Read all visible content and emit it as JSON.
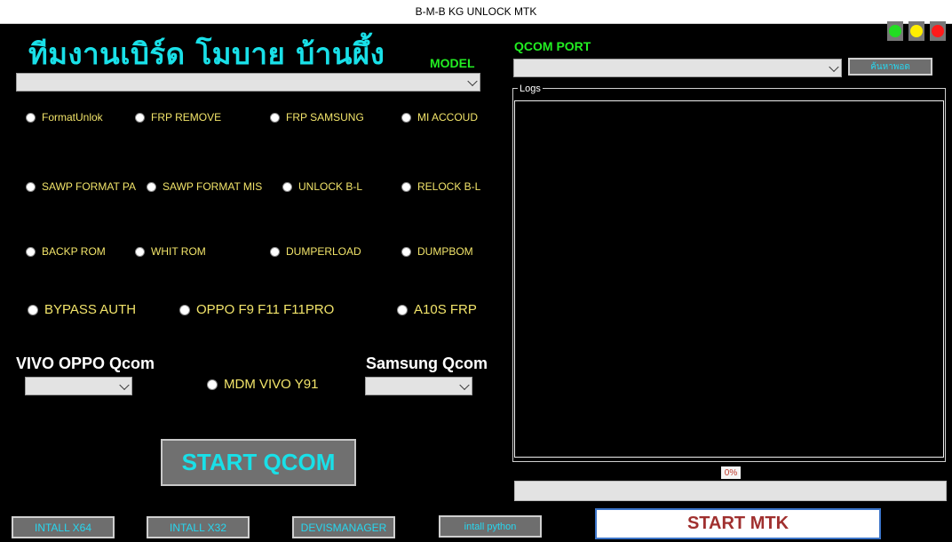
{
  "window": {
    "title": "B-M-B KG UNLOCK MTK"
  },
  "banner": {
    "text": "ทีมงานเบิร์ด โมบาย บ้านผึ้ง"
  },
  "model": {
    "label": "MODEL",
    "selected": ""
  },
  "options": {
    "row1": [
      "FormatUnlok",
      "FRP REMOVE",
      "FRP SAMSUNG",
      "MI ACCOUD"
    ],
    "row2": [
      "SAWP FORMAT PA",
      "SAWP FORMAT MIS",
      "UNLOCK B-L",
      "RELOCK B-L"
    ],
    "row3": [
      "BACKP ROM",
      "WHIT ROM",
      "DUMPERLOAD",
      "DUMPBOM"
    ],
    "row4": [
      "BYPASS AUTH",
      "OPPO F9 F11 F11PRO",
      "A10S FRP"
    ]
  },
  "vivo": {
    "heading": "VIVO OPPO Qcom",
    "selected": "",
    "mdm_label": "MDM VIVO Y91"
  },
  "samsung": {
    "heading": "Samsung Qcom",
    "selected": ""
  },
  "qcom": {
    "start_label": "START QCOM"
  },
  "bottom_buttons": [
    "INTALL X64",
    "INTALL X32",
    "DEVISMANAGER",
    "intall python"
  ],
  "mtk": {
    "start_label": "START MTK"
  },
  "port": {
    "label": "QCOM PORT",
    "selected": "",
    "search_button": "ค้นหาพอด"
  },
  "logs": {
    "legend": "Logs",
    "content": ""
  },
  "progress": {
    "percent_text": "0%",
    "value": 0
  },
  "indicators": [
    {
      "name": "green-indicator",
      "color": "#22dd22"
    },
    {
      "name": "yellow-indicator",
      "color": "#ffee00"
    },
    {
      "name": "red-indicator",
      "color": "#ff1a1a"
    }
  ]
}
